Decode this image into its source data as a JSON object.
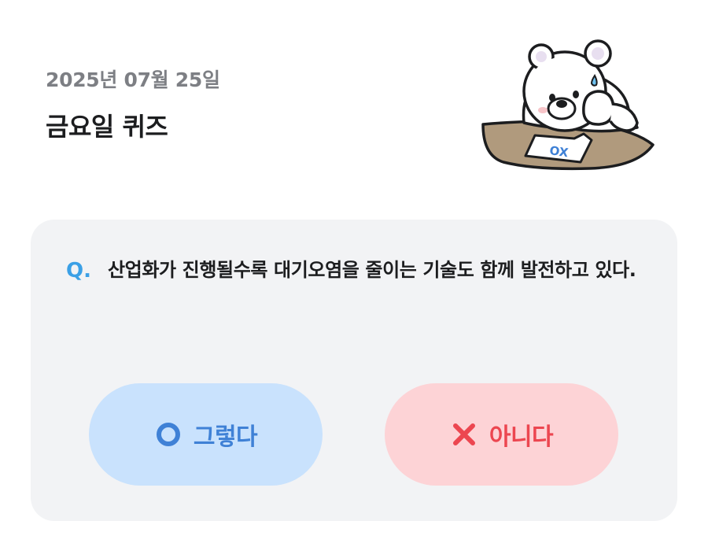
{
  "header": {
    "date": "2025년 07월 25일",
    "title": "금요일 퀴즈"
  },
  "illustration": {
    "name": "polar-bear-quiz-illustration",
    "paper_text": "OX"
  },
  "quiz": {
    "marker": "Q.",
    "question": "산업화가 진행될수록 대기오염을 줄이는 기술도 함께 발전하고 있다."
  },
  "answers": {
    "yes": {
      "label": "그렇다",
      "icon": "circle-o-icon",
      "color": "#3f81d6",
      "background": "#c9e2fd"
    },
    "no": {
      "label": "아니다",
      "icon": "cross-x-icon",
      "color": "#ec4650",
      "background": "#fdd3d6"
    }
  },
  "colors": {
    "card_background": "#f2f3f5",
    "q_marker": "#3ba0e6",
    "date_text": "#7d7f84",
    "title_text": "#1c1d1f"
  }
}
